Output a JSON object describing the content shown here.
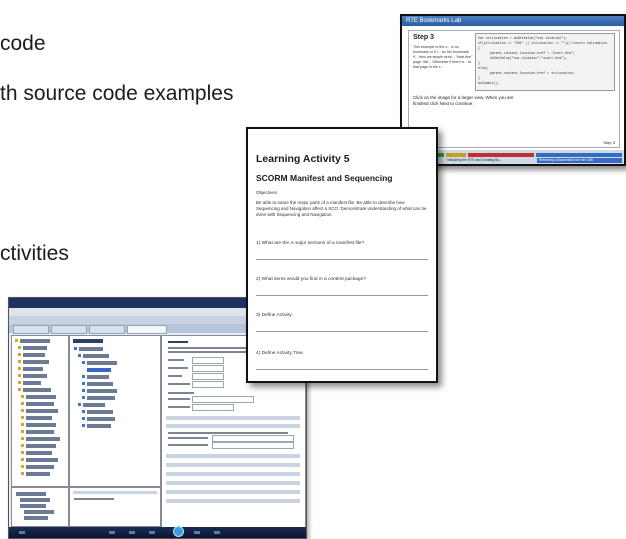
{
  "bullets": [
    "code",
    "th source code examples",
    "ctivities"
  ],
  "lab_screenshot": {
    "window_title": "RTE Bookmarks Lab",
    "step_title": "Step 3",
    "intro_text": "This example to the c... is no bookmark or if t... for the bookmark. If... then we simple send... \"start.htm\" page. We... Otherwise if there is... to that page in the c...",
    "code_text": "Var strLocation = doGetValue(\"cmi.location\");\nif(strLocation == \"401\" || strLocation == \"\"){//return validation.\n{\n      parent.content.location.href = \"start.htm\";\n      doSetValue(\"cmi.location\",\"start.htm\");\n}\nelse{\n      parent.content.location.href = strLocation;\n}\ndoCommit();",
    "click_text": "Click on the image for a larger view. When you are finished click Next to continue.",
    "step_counter": "Step 3",
    "nav_left": "Introduction",
    "nav_mid": "Initializing the RTE and Creating Bo...",
    "nav_right": "Retrieving a Bookmark from the LMS"
  },
  "activity_screenshot": {
    "title": "Learning Activity 5",
    "subtitle": "SCORM Manifest and Sequencing",
    "objectives_label": "Objectives",
    "objectives_text": "Be able to name the major parts of a manifest file. Be able to describe how Sequencing and Navigation affect a SCO. Demonstrate understanding of what can be done with Sequencing and Navigation.",
    "questions": [
      "1) What are the 4 major sections of a manifest file?",
      "2) What items would you find in a content package?",
      "3) Define Activity.",
      "4) Define Activity Tree."
    ]
  },
  "tool_screenshot": {
    "colors": {
      "title_bar": "#1d3260",
      "taskbar": "#0b1430",
      "folder": "#d4a625",
      "orb": "#3f9be0"
    }
  }
}
